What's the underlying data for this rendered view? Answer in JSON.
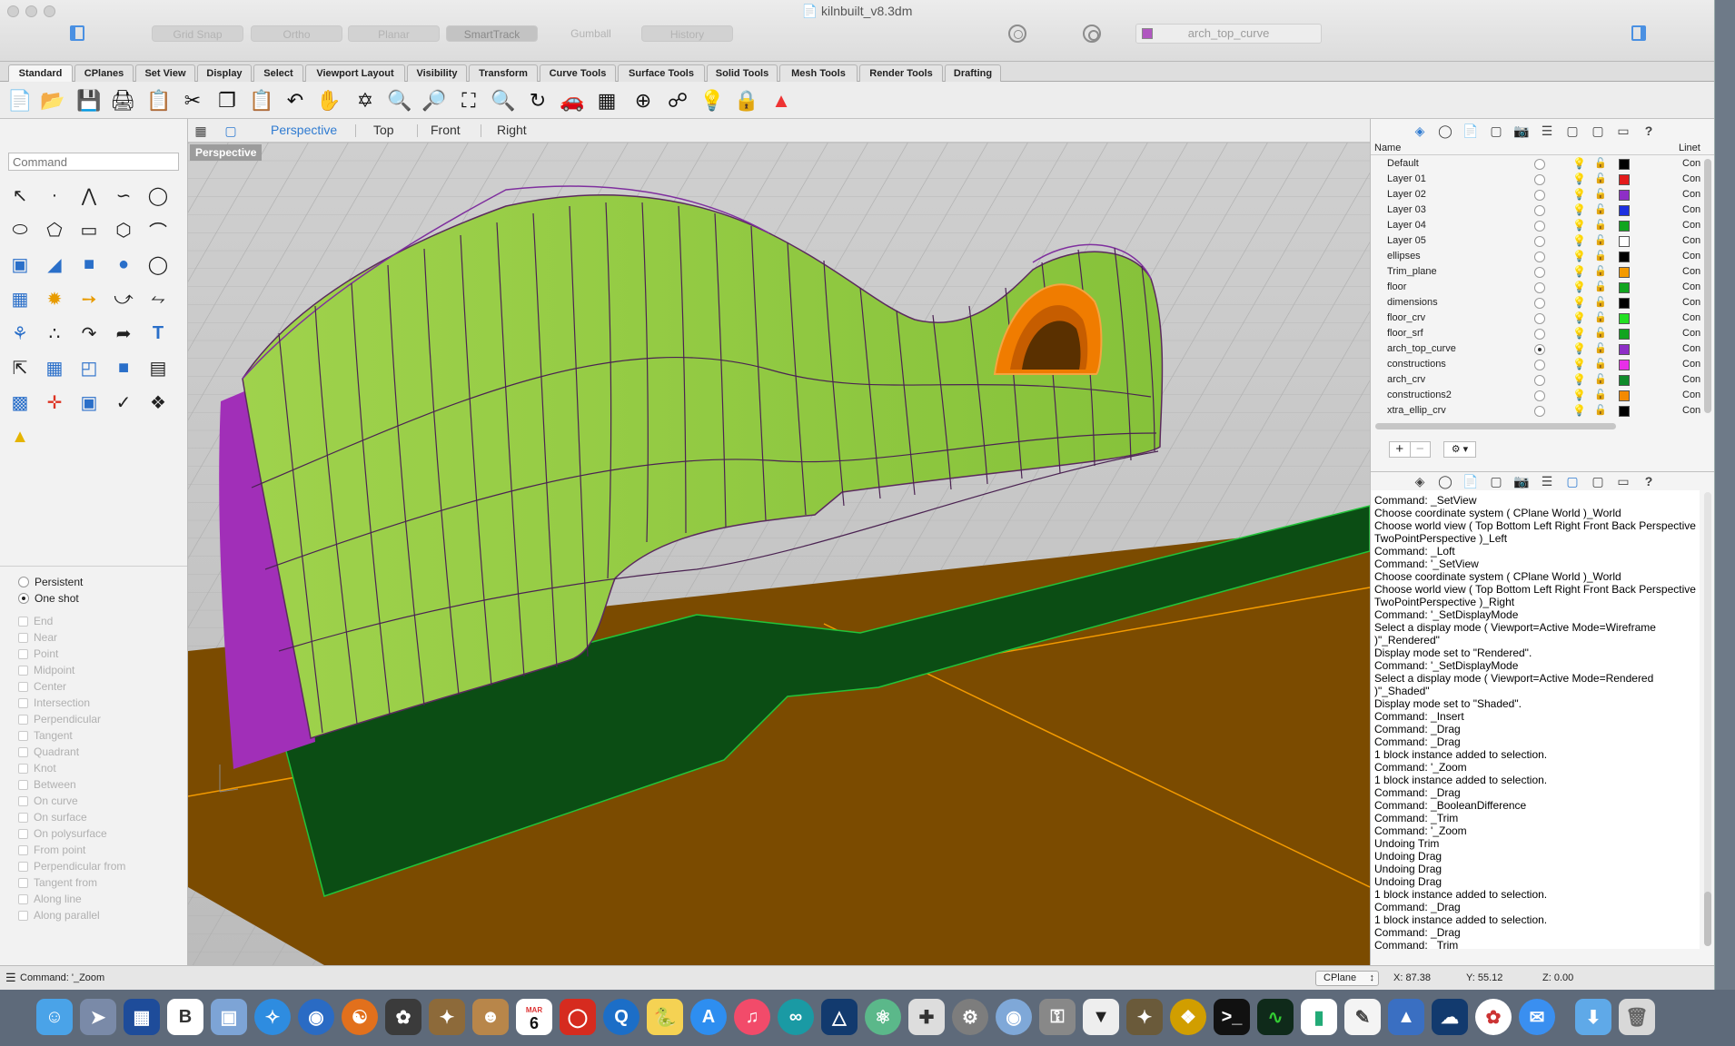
{
  "window": {
    "title": "kilnbuilt_v8.3dm",
    "toggles": [
      "Grid Snap",
      "Ortho",
      "Planar",
      "SmartTrack",
      "Gumball",
      "History"
    ],
    "current_layer": "arch_top_curve"
  },
  "tabs": [
    "Standard",
    "CPlanes",
    "Set View",
    "Display",
    "Select",
    "Viewport Layout",
    "Visibility",
    "Transform",
    "Curve Tools",
    "Surface Tools",
    "Solid Tools",
    "Mesh Tools",
    "Render Tools",
    "Drafting"
  ],
  "toolbar_icons": [
    "new-icon",
    "open-icon",
    "save-icon",
    "print-icon",
    "import-icon",
    "cut-icon",
    "copy-icon",
    "paste-icon",
    "undo-icon",
    "pan-icon",
    "rotate-view-icon",
    "zoom-icon",
    "zoom-window-icon",
    "zoom-extents-icon",
    "zoom-selected-icon",
    "zoom-target-icon",
    "car-icon",
    "grid-icon",
    "osnap-icon",
    "smarttrack-icon",
    "light-icon",
    "lock-icon",
    "render-icon"
  ],
  "left_panel": {
    "command_placeholder": "Command",
    "mode_options": [
      {
        "label": "Persistent",
        "selected": false
      },
      {
        "label": "One shot",
        "selected": true
      }
    ],
    "osnaps": [
      "End",
      "Near",
      "Point",
      "Midpoint",
      "Center",
      "Intersection",
      "Perpendicular",
      "Tangent",
      "Quadrant",
      "Knot",
      "Between",
      "On curve",
      "On surface",
      "On polysurface",
      "From point",
      "Perpendicular from",
      "Tangent from",
      "Along line",
      "Along parallel"
    ]
  },
  "viewport": {
    "tabs": [
      "Perspective",
      "Top",
      "Front",
      "Right"
    ],
    "active_tab": "Perspective",
    "label": "Perspective"
  },
  "layers": {
    "header_name": "Name",
    "header_linetype": "Linet",
    "rows": [
      {
        "name": "Default",
        "color": "#000000",
        "current": false,
        "linetype": "Con"
      },
      {
        "name": "Layer 01",
        "color": "#e31b1b",
        "current": false,
        "linetype": "Con"
      },
      {
        "name": "Layer 02",
        "color": "#8e2fc6",
        "current": false,
        "linetype": "Con"
      },
      {
        "name": "Layer 03",
        "color": "#1c2fe0",
        "current": false,
        "linetype": "Con"
      },
      {
        "name": "Layer 04",
        "color": "#11a51f",
        "current": false,
        "linetype": "Con"
      },
      {
        "name": "Layer 05",
        "color": "#ffffff",
        "current": false,
        "linetype": "Con"
      },
      {
        "name": "ellipses",
        "color": "#000000",
        "current": false,
        "linetype": "Con"
      },
      {
        "name": "Trim_plane",
        "color": "#f39a00",
        "current": false,
        "linetype": "Con"
      },
      {
        "name": "floor",
        "color": "#11a51f",
        "current": false,
        "linetype": "Con"
      },
      {
        "name": "dimensions",
        "color": "#000000",
        "current": false,
        "linetype": "Con"
      },
      {
        "name": "floor_crv",
        "color": "#22e022",
        "current": false,
        "linetype": "Con"
      },
      {
        "name": "floor_srf",
        "color": "#11a51f",
        "current": false,
        "linetype": "Con"
      },
      {
        "name": "arch_top_curve",
        "color": "#8e2fc6",
        "current": true,
        "linetype": "Con"
      },
      {
        "name": "constructions",
        "color": "#e72fe7",
        "current": false,
        "linetype": "Con"
      },
      {
        "name": "arch_crv",
        "color": "#0f8a2a",
        "current": false,
        "linetype": "Con"
      },
      {
        "name": "constructions2",
        "color": "#f38a00",
        "current": false,
        "linetype": "Con"
      },
      {
        "name": "xtra_ellip_crv",
        "color": "#000000",
        "current": false,
        "linetype": "Con"
      }
    ]
  },
  "history": "Command: _SetView\nChoose coordinate system ( CPlane World )_World\nChoose world view ( Top Bottom Left Right Front Back Perspective TwoPointPerspective )_Left\nCommand: _Loft\nCommand: '_SetView\nChoose coordinate system ( CPlane World )_World\nChoose world view ( Top Bottom Left Right Front Back Perspective TwoPointPerspective )_Right\nCommand: '_SetDisplayMode\nSelect a display mode ( Viewport=Active Mode=Wireframe )\"_Rendered\"\nDisplay mode set to \"Rendered\".\nCommand: '_SetDisplayMode\nSelect a display mode ( Viewport=Active Mode=Rendered )\"_Shaded\"\nDisplay mode set to \"Shaded\".\nCommand: _Insert\nCommand: _Drag\nCommand: _Drag\n1 block instance added to selection.\nCommand: '_Zoom\n1 block instance added to selection.\nCommand: _Drag\nCommand: _BooleanDifference\nCommand: _Trim\nCommand: '_Zoom\nUndoing Trim\nUndoing Drag\nUndoing Drag\nUndoing Drag\n1 block instance added to selection.\nCommand: _Drag\n1 block instance added to selection.\nCommand: _Drag\nCommand: _Trim\nCommand: '_Zoom",
  "status": {
    "last_command": "Command: '_Zoom",
    "cplane": "CPlane",
    "x": "X: 87.38",
    "y": "Y: 55.12",
    "z": "Z: 0.00"
  },
  "dock": {
    "calendar_month": "MAR",
    "calendar_day": "6",
    "apps": [
      "finder-icon",
      "launchpad-icon",
      "app-store-icon",
      "bbedit-icon",
      "preview-icon",
      "safari-icon",
      "google-earth-icon",
      "firefox-icon",
      "rhino-icon",
      "gimp-icon",
      "contacts-icon",
      "calendar-icon",
      "acrobat-icon",
      "quicktime-icon",
      "python-icon",
      "appstore-icon",
      "itunes-icon",
      "arduino-icon",
      "remote-icon",
      "atom-icon",
      "grapher-icon",
      "system-prefs-icon",
      "eye-icon",
      "keychain-icon",
      "inkscape-icon",
      "gimp2-icon",
      "rhino-badge-icon",
      "terminal-icon",
      "activity-monitor-icon",
      "numbers-icon",
      "textedit-icon",
      "keynote-icon",
      "network-icon",
      "pinwheel-icon",
      "messages-icon",
      "downloads-icon",
      "trash-icon"
    ]
  }
}
